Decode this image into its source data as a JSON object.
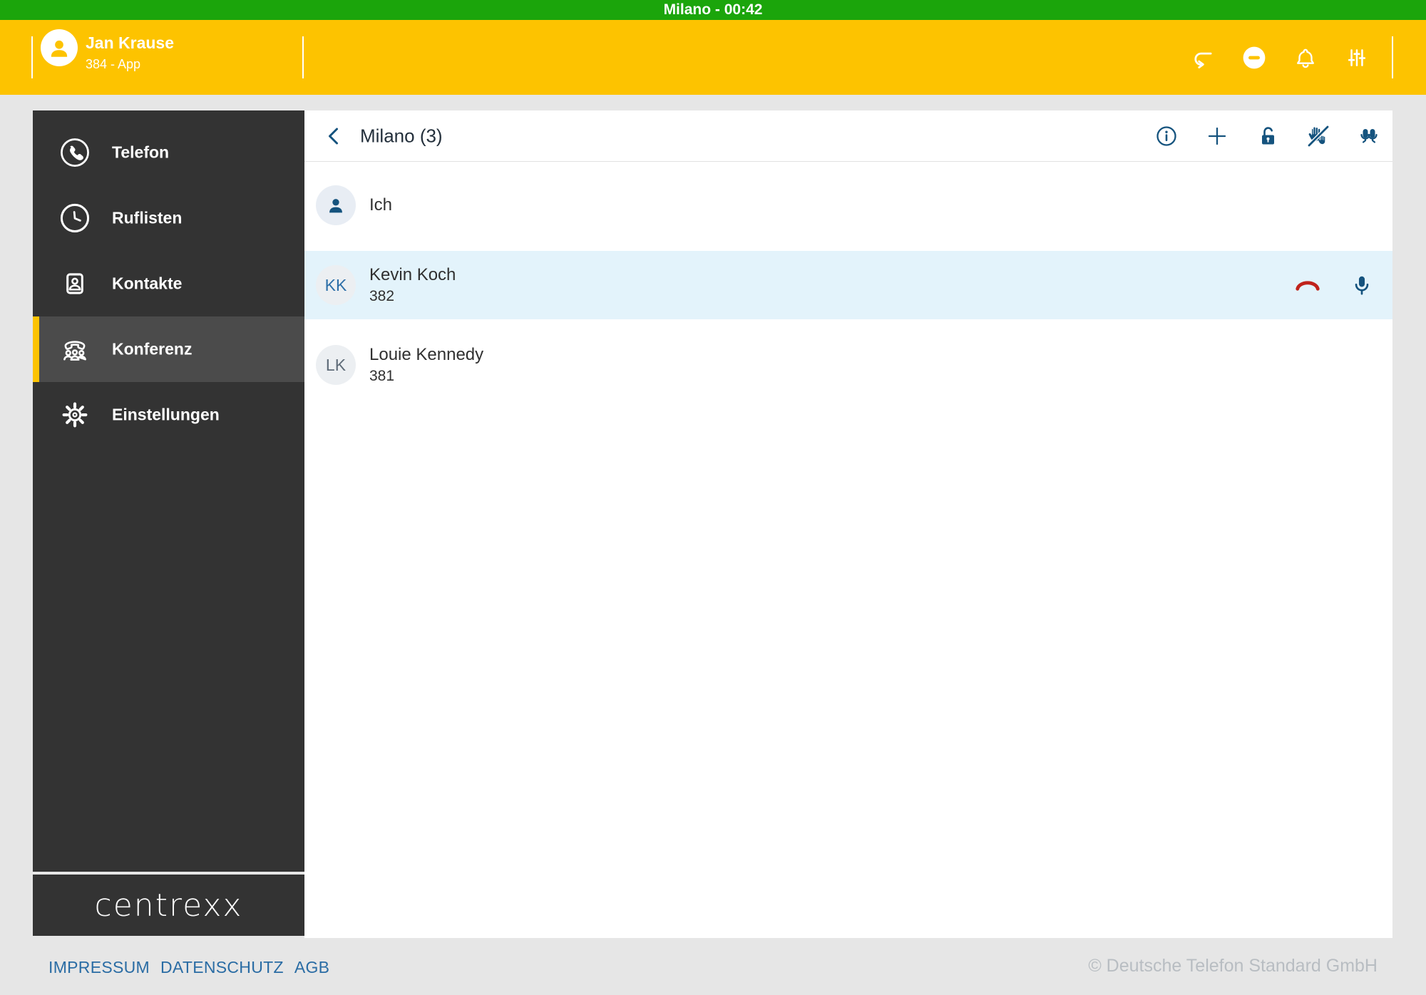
{
  "colors": {
    "status_green": "#1BA50B",
    "header_yellow": "#FDC300",
    "sidebar_dark": "#333333",
    "sidebar_active": "#4B4B4B",
    "accent_blue": "#15537E",
    "highlight_row_blue": "#E3F3FB",
    "danger_red": "#C0231C"
  },
  "status_bar": {
    "title": "Milano - 00:42"
  },
  "header": {
    "user": {
      "name": "Jan Krause",
      "extension": "384 - App"
    },
    "icons": [
      "call-forward-icon",
      "do-not-disturb-icon",
      "notifications-bell-icon",
      "audio-tune-icon"
    ]
  },
  "sidebar": {
    "items": [
      {
        "label": "Telefon",
        "icon": "phone-icon",
        "active": false
      },
      {
        "label": "Ruflisten",
        "icon": "call-history-clock-icon",
        "active": false
      },
      {
        "label": "Kontakte",
        "icon": "contacts-icon",
        "active": false
      },
      {
        "label": "Konferenz",
        "icon": "conference-icon",
        "active": true
      },
      {
        "label": "Einstellungen",
        "icon": "settings-gear-icon",
        "active": false
      }
    ],
    "logo": "centrexx"
  },
  "conference": {
    "title": "Milano (3)",
    "toolbar_icons": [
      "info-icon",
      "add-participant-icon",
      "unlock-icon",
      "lower-hands-icon",
      "mute-all-icon"
    ],
    "participants": [
      {
        "name": "Ich",
        "number": "",
        "initials": "",
        "highlighted": false
      },
      {
        "name": "Kevin Koch",
        "number": "382",
        "initials": "KK",
        "highlighted": true,
        "actions": [
          "hangup-icon",
          "microphone-icon"
        ]
      },
      {
        "name": "Louie Kennedy",
        "number": "381",
        "initials": "LK",
        "highlighted": false
      }
    ]
  },
  "footer": {
    "links": [
      "IMPRESSUM",
      "DATENSCHUTZ",
      "AGB"
    ],
    "copyright": "© Deutsche Telefon Standard GmbH"
  }
}
